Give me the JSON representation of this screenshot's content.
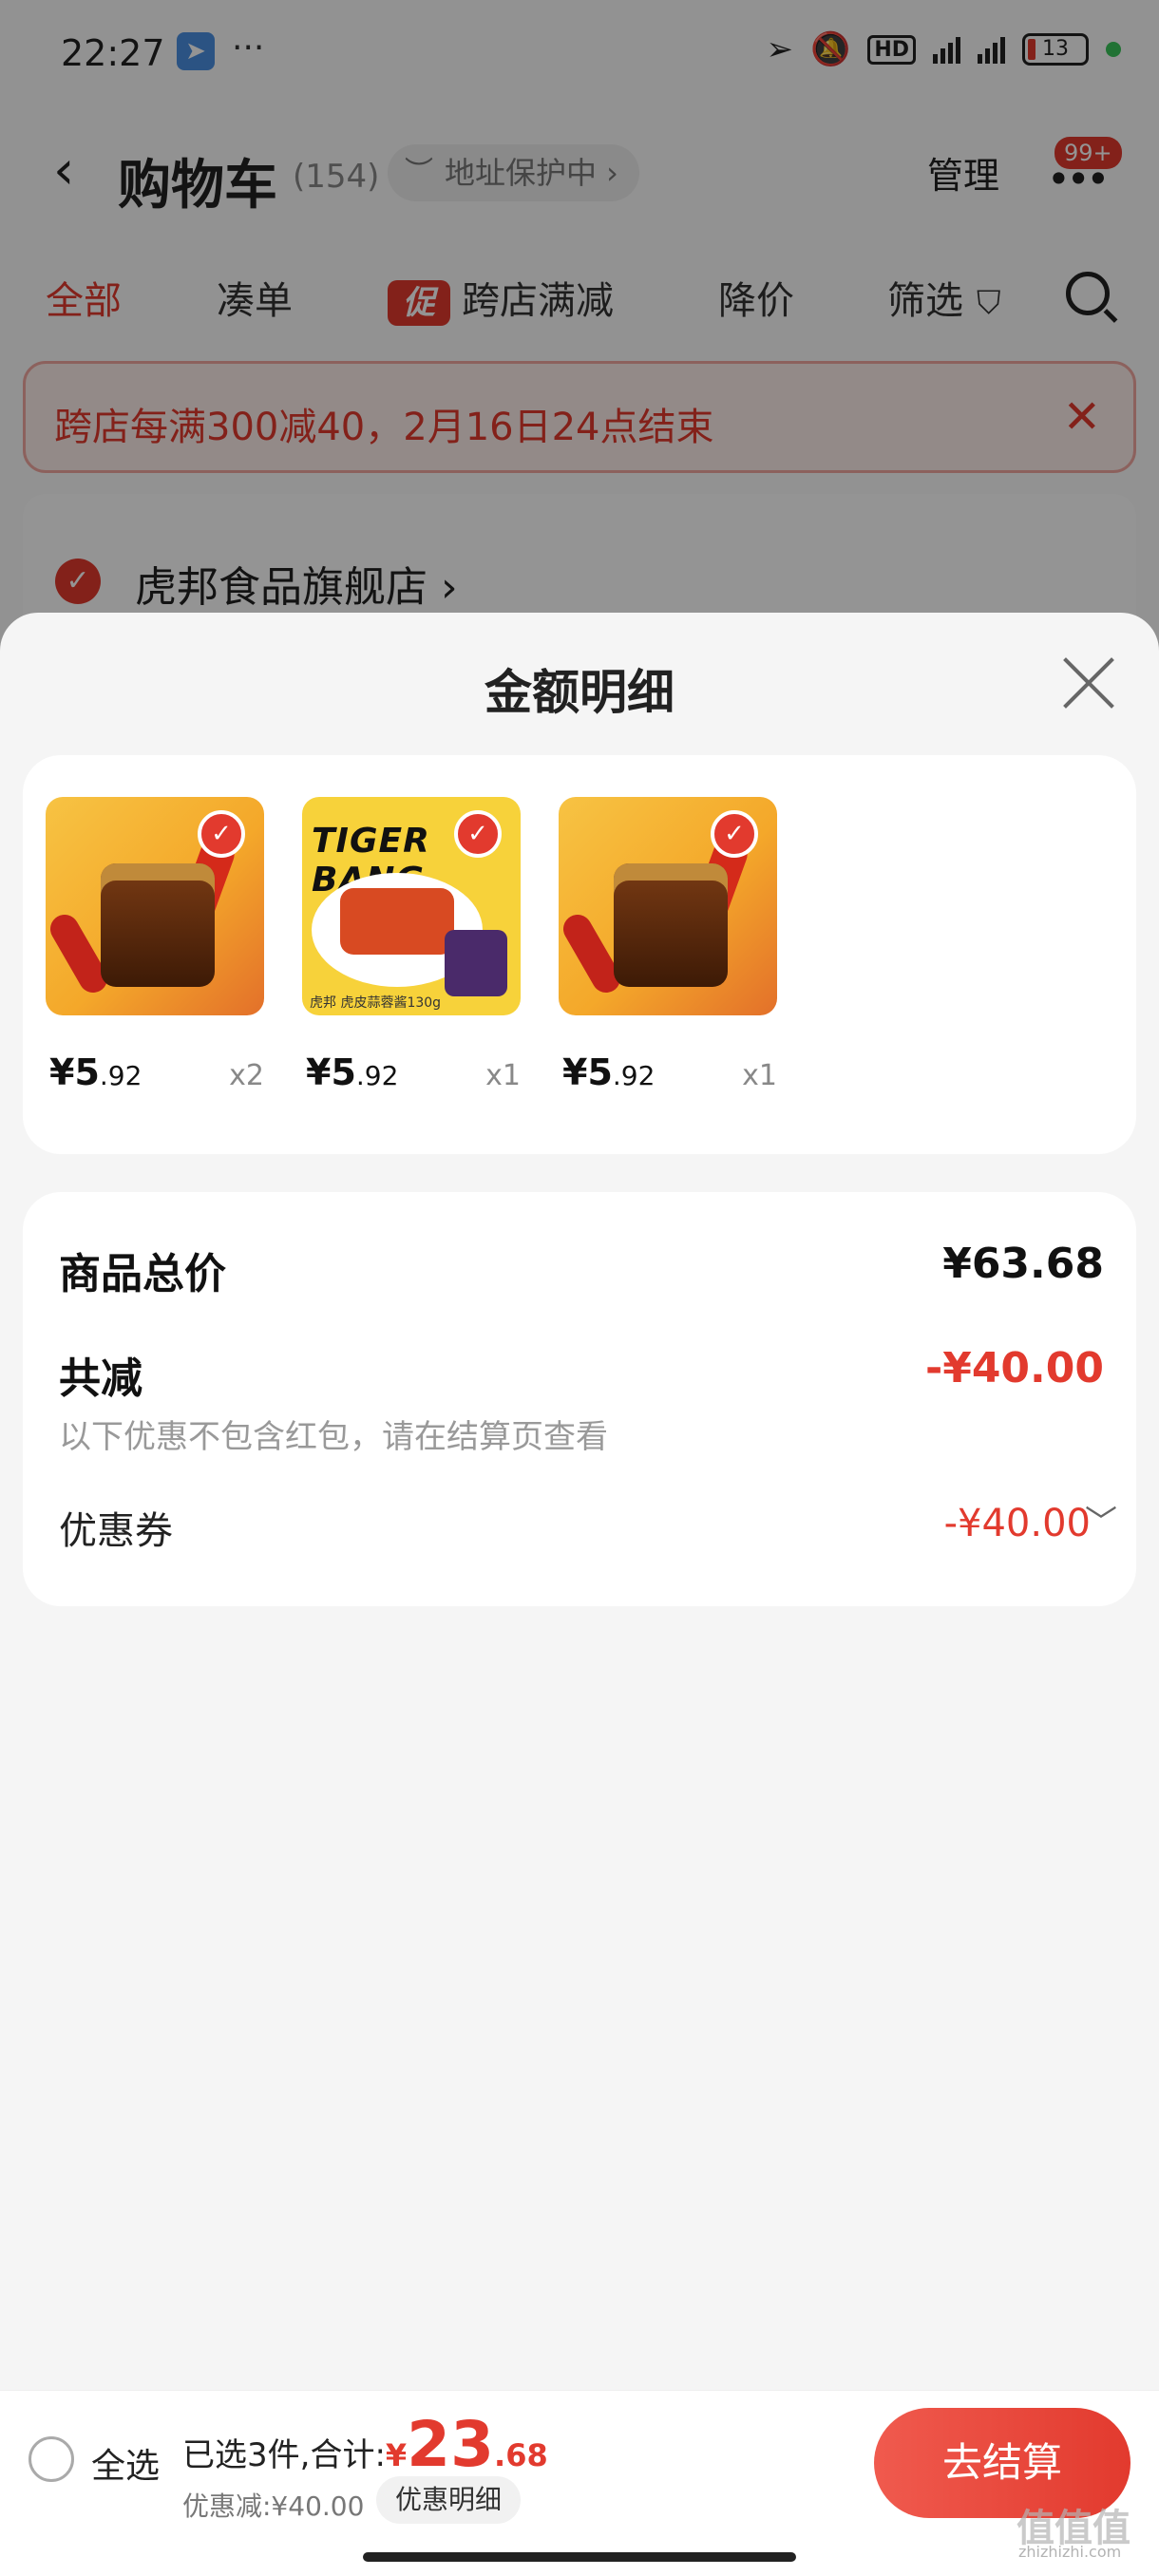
{
  "status": {
    "time": "22:27",
    "battery": "13",
    "dots": "···",
    "hd": "HD"
  },
  "header": {
    "title": "购物车",
    "count": "(154)",
    "address_protect": "地址保护中 ›",
    "manage": "管理",
    "badge": "99+"
  },
  "tabs": [
    {
      "label": "全部"
    },
    {
      "label": "凑单"
    },
    {
      "label": "跨店满减",
      "prefix": "促"
    },
    {
      "label": "降价"
    },
    {
      "label": "筛选"
    }
  ],
  "promo": {
    "text": "跨店每满300减40，2月16日24点结束",
    "close": "✕"
  },
  "store": {
    "name": "虎邦食品旗舰店 ›"
  },
  "sheet": {
    "title": "金额明细",
    "products": [
      {
        "price_int": "¥5",
        "price_dec": ".92",
        "qty": "x2"
      },
      {
        "price_int": "¥5",
        "price_dec": ".92",
        "qty": "x1",
        "brand_text": "TIGER BANG",
        "caption": "虎邦  虎皮蒜蓉酱130g"
      },
      {
        "price_int": "¥5",
        "price_dec": ".92",
        "qty": "x1"
      }
    ],
    "summary": {
      "total_label": "商品总价",
      "total_value": "¥63.68",
      "discount_label": "共减",
      "discount_value": "-¥40.00",
      "note": "以下优惠不包含红包，请在结算页查看",
      "coupon_label": "优惠券",
      "coupon_value": "-¥40.00"
    }
  },
  "bottom": {
    "select_all": "全选",
    "selected_text": "已选3件,合计:",
    "rmb": "¥",
    "total_int": "23",
    "total_dec": ".68",
    "discount_line": "优惠减:¥40.00",
    "detail_chip": "优惠明细",
    "checkout": "去结算",
    "watermark": "值值值",
    "watermark_sub": "zhizhizhi.com"
  },
  "colors": {
    "accent": "#e23a2e",
    "bg": "#f5f5f5",
    "card": "#ffffff"
  }
}
